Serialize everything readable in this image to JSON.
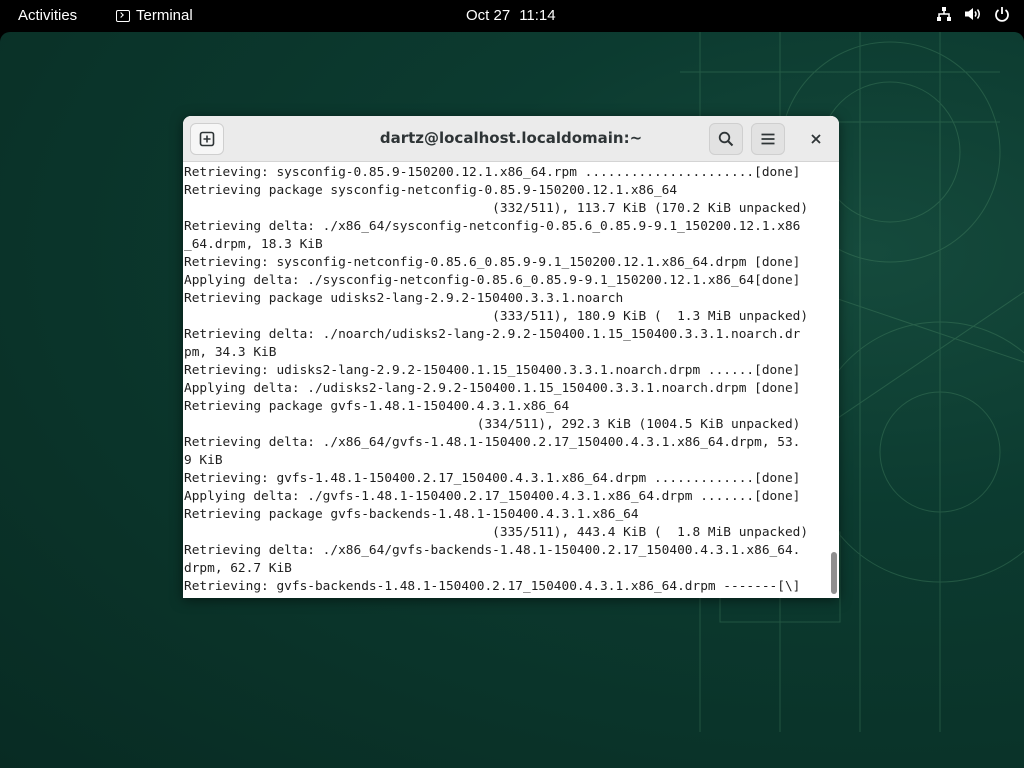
{
  "topbar": {
    "activities": "Activities",
    "app_name": "Terminal",
    "app_icon": "terminal-icon",
    "date": "Oct 27",
    "time": "11:14",
    "tray_icons": [
      "network-icon",
      "volume-icon",
      "power-icon"
    ]
  },
  "window": {
    "title": "dartz@localhost.localdomain:~",
    "buttons": {
      "new_tab": "new-tab-icon",
      "search": "search-icon",
      "menu": "hamburger-menu-icon",
      "close": "close-icon"
    }
  },
  "terminal": {
    "lines": [
      "Retrieving: sysconfig-0.85.9-150200.12.1.x86_64.rpm ......................[done]",
      "Retrieving package sysconfig-netconfig-0.85.9-150200.12.1.x86_64",
      "                                        (332/511), 113.7 KiB (170.2 KiB unpacked)",
      "Retrieving delta: ./x86_64/sysconfig-netconfig-0.85.6_0.85.9-9.1_150200.12.1.x86",
      "_64.drpm, 18.3 KiB",
      "Retrieving: sysconfig-netconfig-0.85.6_0.85.9-9.1_150200.12.1.x86_64.drpm [done]",
      "Applying delta: ./sysconfig-netconfig-0.85.6_0.85.9-9.1_150200.12.1.x86_64[done]",
      "Retrieving package udisks2-lang-2.9.2-150400.3.3.1.noarch",
      "                                        (333/511), 180.9 KiB (  1.3 MiB unpacked)",
      "Retrieving delta: ./noarch/udisks2-lang-2.9.2-150400.1.15_150400.3.3.1.noarch.dr",
      "pm, 34.3 KiB",
      "Retrieving: udisks2-lang-2.9.2-150400.1.15_150400.3.3.1.noarch.drpm ......[done]",
      "Applying delta: ./udisks2-lang-2.9.2-150400.1.15_150400.3.3.1.noarch.drpm [done]",
      "Retrieving package gvfs-1.48.1-150400.4.3.1.x86_64",
      "                                      (334/511), 292.3 KiB (1004.5 KiB unpacked)",
      "Retrieving delta: ./x86_64/gvfs-1.48.1-150400.2.17_150400.4.3.1.x86_64.drpm, 53.",
      "9 KiB",
      "Retrieving: gvfs-1.48.1-150400.2.17_150400.4.3.1.x86_64.drpm .............[done]",
      "Applying delta: ./gvfs-1.48.1-150400.2.17_150400.4.3.1.x86_64.drpm .......[done]",
      "Retrieving package gvfs-backends-1.48.1-150400.4.3.1.x86_64",
      "                                        (335/511), 443.4 KiB (  1.8 MiB unpacked)",
      "Retrieving delta: ./x86_64/gvfs-backends-1.48.1-150400.2.17_150400.4.3.1.x86_64.",
      "drpm, 62.7 KiB",
      "Retrieving: gvfs-backends-1.48.1-150400.2.17_150400.4.3.1.x86_64.drpm -------[\\]"
    ]
  },
  "colors": {
    "topbar_bg": "#000000",
    "desktop_bg": "#0a3329",
    "headerbar_bg": "#ebebeb",
    "terminal_bg": "#ffffff",
    "terminal_fg": "#1e1e1e"
  }
}
